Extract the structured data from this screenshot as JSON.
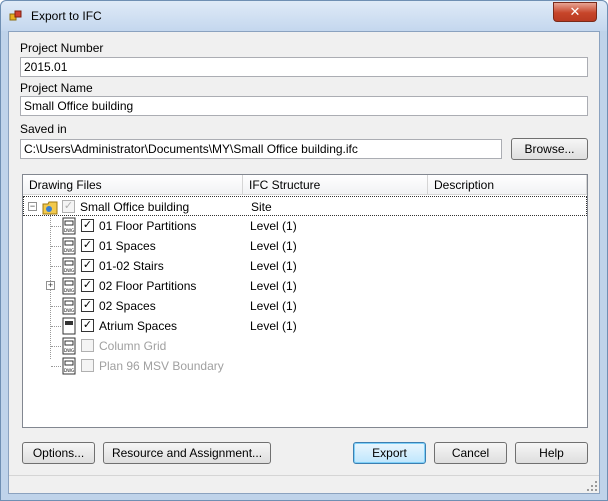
{
  "window": {
    "title": "Export to IFC",
    "close_symbol": "✕"
  },
  "fields": {
    "project_number_label": "Project Number",
    "project_number_value": "2015.01",
    "project_name_label": "Project Name",
    "project_name_value": "Small Office building",
    "saved_in_label": "Saved in",
    "saved_in_value": "C:\\Users\\Administrator\\Documents\\MY\\Small Office building.ifc",
    "browse_label": "Browse..."
  },
  "list": {
    "columns": [
      "Drawing Files",
      "IFC Structure",
      "Description"
    ],
    "root": {
      "name": "Small Office building",
      "structure": "Site",
      "checked": true,
      "disabled": true
    },
    "items": [
      {
        "name": "01 Floor Partitions",
        "structure": "Level (1)",
        "checked": true,
        "disabled": false,
        "expandable": false
      },
      {
        "name": "01 Spaces",
        "structure": "Level (1)",
        "checked": true,
        "disabled": false,
        "expandable": false
      },
      {
        "name": "01-02 Stairs",
        "structure": "Level (1)",
        "checked": true,
        "disabled": false,
        "expandable": false
      },
      {
        "name": "02 Floor Partitions",
        "structure": "Level (1)",
        "checked": true,
        "disabled": false,
        "expandable": true
      },
      {
        "name": "02 Spaces",
        "structure": "Level (1)",
        "checked": true,
        "disabled": false,
        "expandable": false
      },
      {
        "name": "Atrium Spaces",
        "structure": "Level (1)",
        "checked": true,
        "disabled": false,
        "expandable": false
      },
      {
        "name": "Column Grid",
        "structure": "",
        "checked": false,
        "disabled": true,
        "expandable": false
      },
      {
        "name": "Plan 96 MSV Boundary",
        "structure": "",
        "checked": false,
        "disabled": true,
        "expandable": false
      }
    ]
  },
  "buttons": {
    "options": "Options...",
    "resource": "Resource and Assignment...",
    "export": "Export",
    "cancel": "Cancel",
    "help": "Help"
  },
  "colors": {
    "title_bg": "#c4d7ee",
    "close_red": "#c7452a",
    "client_bg": "#f0f0f0"
  }
}
